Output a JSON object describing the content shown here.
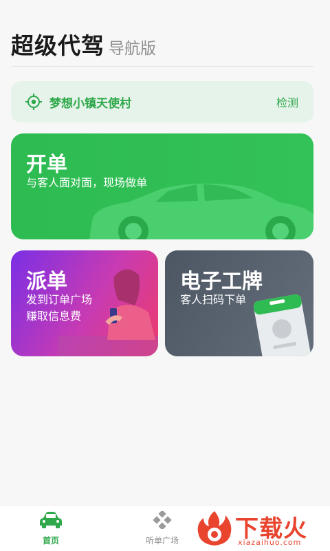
{
  "header": {
    "title": "超级代驾",
    "subtitle": "导航版"
  },
  "location": {
    "name": "梦想小镇天使村",
    "action": "检测"
  },
  "cards": {
    "open": {
      "title": "开单",
      "subtitle": "与客人面对面，现场做单"
    },
    "dispatch": {
      "title": "派单",
      "line1": "发到订单广场",
      "line2": "赚取信息费"
    },
    "badge": {
      "title": "电子工牌",
      "subtitle": "客人扫码下单"
    }
  },
  "tabs": [
    {
      "label": "首页",
      "active": true
    },
    {
      "label": "听单广场",
      "active": false
    }
  ],
  "watermark": {
    "text": "下载火",
    "sub": "xiazaihuo.com"
  },
  "colors": {
    "green": "#2ea84a",
    "cardGreen": "#2dbb52",
    "purple": "#7a2fe6",
    "pink": "#ee3b6b",
    "slate": "#4d5663",
    "watermark": "#e8442e"
  }
}
